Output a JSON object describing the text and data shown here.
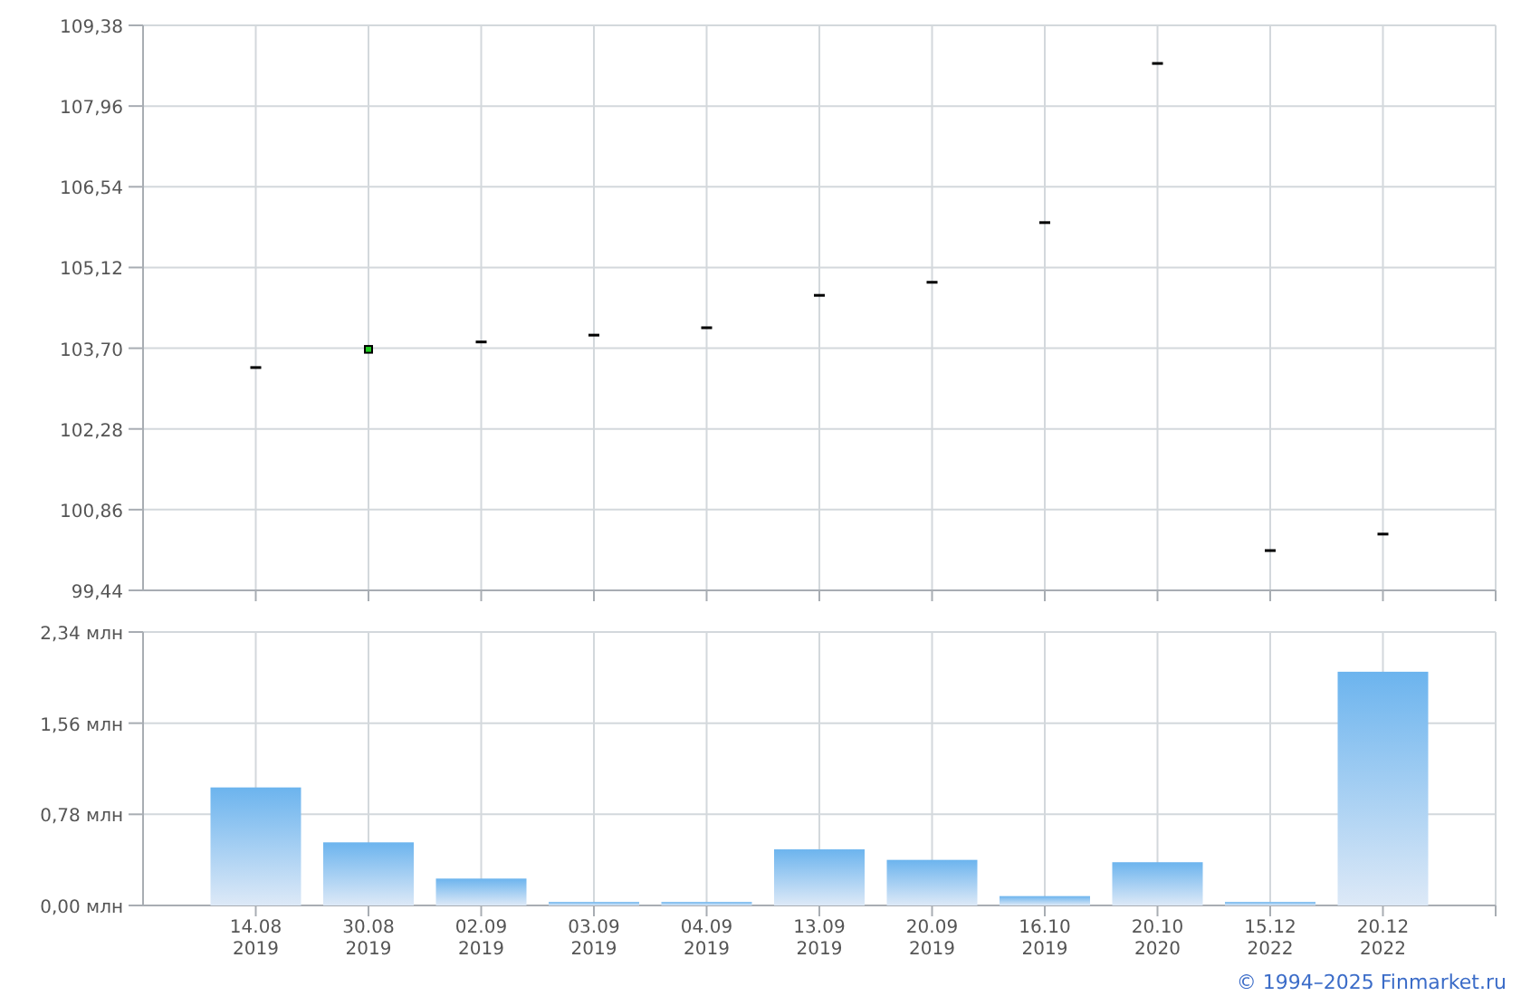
{
  "price_chart": {
    "chart_data": {
      "type": "candlestick",
      "categories": [
        null,
        null,
        null,
        null,
        null,
        null,
        null,
        null,
        null,
        null,
        null
      ],
      "ohlc": [
        [
          103.36,
          103.36,
          103.36,
          103.36
        ],
        [
          103.62,
          103.74,
          103.62,
          103.74
        ],
        [
          103.81,
          103.81,
          103.81,
          103.81
        ],
        [
          103.93,
          103.93,
          103.93,
          103.93
        ],
        [
          104.06,
          104.06,
          104.06,
          104.06
        ],
        [
          104.63,
          104.63,
          104.63,
          104.63
        ],
        [
          104.86,
          104.86,
          104.86,
          104.86
        ],
        [
          105.91,
          105.91,
          105.91,
          105.91
        ],
        [
          108.71,
          108.71,
          108.71,
          108.71
        ],
        [
          100.14,
          100.14,
          100.14,
          100.14
        ],
        [
          100.43,
          100.43,
          100.43,
          100.43
        ]
      ],
      "ylim": [
        99.44,
        109.38
      ],
      "yticks": [
        {
          "value": 109.38,
          "label": "109,38"
        },
        {
          "value": 107.96,
          "label": "107,96"
        },
        {
          "value": 106.54,
          "label": "106,54"
        },
        {
          "value": 105.12,
          "label": "105,12"
        },
        {
          "value": 103.7,
          "label": "103,70"
        },
        {
          "value": 102.28,
          "label": "102,28"
        },
        {
          "value": 100.86,
          "label": "100,86"
        },
        {
          "value": 99.44,
          "label": "99,44"
        }
      ],
      "grid": true
    }
  },
  "volume_chart": {
    "chart_data": {
      "type": "bar",
      "categories": [
        "14.08 2019",
        "30.08 2019",
        "02.09 2019",
        "03.09 2019",
        "04.09 2019",
        "13.09 2019",
        "20.09 2019",
        "16.10 2019",
        "20.10 2020",
        "15.12 2022",
        "20.12 2022"
      ],
      "values": [
        1.01,
        0.54,
        0.23,
        0.03,
        0.03,
        0.48,
        0.39,
        0.08,
        0.37,
        0.03,
        2.0
      ],
      "ylim": [
        0,
        2.34
      ],
      "grid": true,
      "yticks": [
        {
          "value": 2.34,
          "label": "2,34 млн"
        },
        {
          "value": 1.56,
          "label": "1,56 млн"
        },
        {
          "value": 0.78,
          "label": "0,78 млн"
        },
        {
          "value": 0,
          "label": "0,00 млн"
        }
      ]
    }
  },
  "footer": {
    "copyright": "© 1994–2025 Finmarket.ru"
  }
}
